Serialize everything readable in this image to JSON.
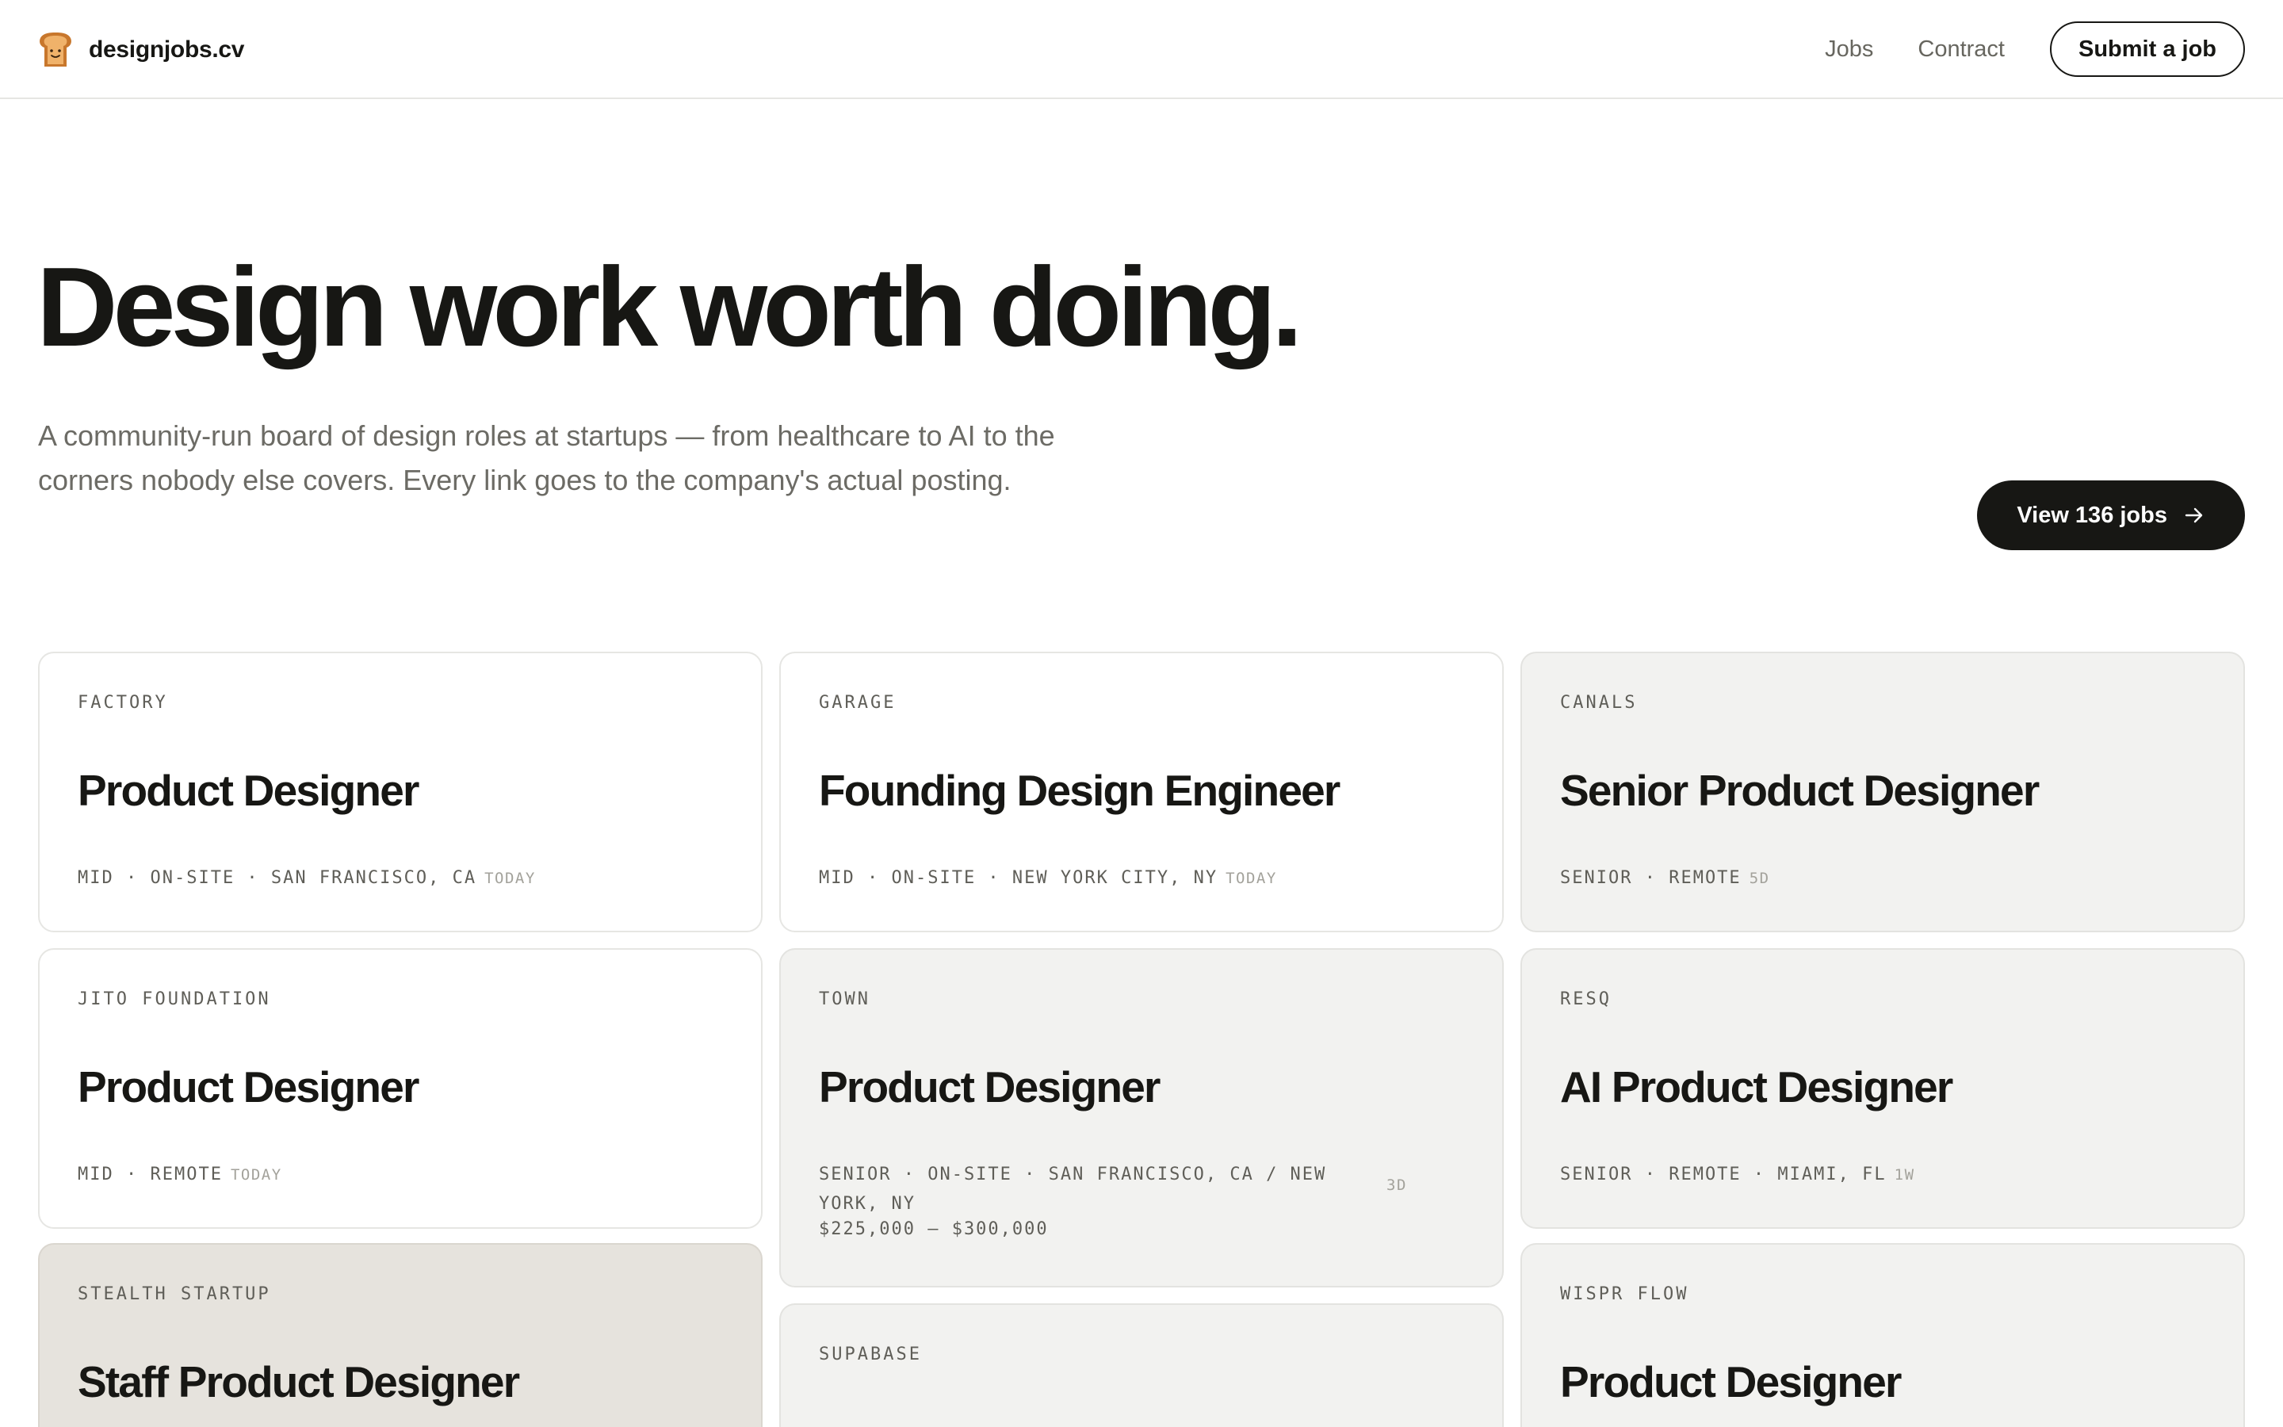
{
  "header": {
    "brand": "designjobs.cv",
    "nav": [
      {
        "label": "Jobs"
      },
      {
        "label": "Contract"
      }
    ],
    "submit_label": "Submit a job"
  },
  "hero": {
    "title": "Design work worth doing.",
    "lede": "A community-run board of design roles at startups — from healthcare to AI to the corners nobody else covers. Every link goes to the company's actual posting.",
    "cta_label": "View 136 jobs"
  },
  "colors": {
    "ink": "#171714",
    "muted_text": "#6c6b65",
    "card_border": "#e6e6e3",
    "card_grey": "#f2f2f0",
    "card_stone": "#e6e3dd",
    "brand_icon": "#c8772c"
  },
  "icons": {
    "brand": "toast-icon",
    "cta": "arrow-right-icon"
  },
  "jobs": [
    {
      "company": "FACTORY",
      "title": "Product Designer",
      "meta": "MID · ON-SITE · SAN FRANCISCO, CA",
      "age": "TODAY",
      "style": "white"
    },
    {
      "company": "GARAGE",
      "title": "Founding Design Engineer",
      "meta": "MID · ON-SITE · NEW YORK CITY, NY",
      "age": "TODAY",
      "style": "white"
    },
    {
      "company": "CANALS",
      "title": "Senior Product Designer",
      "meta": "SENIOR · REMOTE",
      "age": "5D",
      "style": "grey"
    },
    {
      "company": "JITO FOUNDATION",
      "title": "Product Designer",
      "meta": "MID · REMOTE",
      "age": "TODAY",
      "style": "white"
    },
    {
      "company": "TOWN",
      "title": "Product Designer",
      "meta": "SENIOR · ON-SITE · SAN FRANCISCO, CA / NEW YORK, NY",
      "salary": "$225,000 – $300,000",
      "age": "3D",
      "style": "grey"
    },
    {
      "company": "RESQ",
      "title": "AI Product Designer",
      "meta": "SENIOR · REMOTE · MIAMI, FL",
      "age": "1W",
      "style": "grey"
    },
    {
      "company": "STEALTH STARTUP",
      "title": "Staff Product Designer",
      "style": "stone"
    },
    {
      "company": "SUPABASE",
      "style": "grey"
    },
    {
      "company": "WISPR FLOW",
      "title": "Product Designer",
      "style": "grey"
    }
  ]
}
